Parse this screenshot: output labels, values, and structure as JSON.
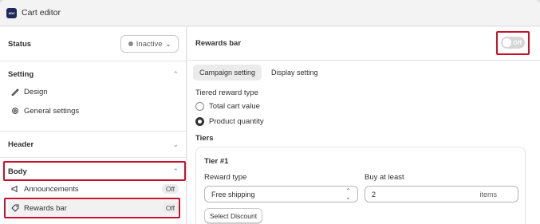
{
  "app": {
    "logo_text": "ADV",
    "title": "Cart editor"
  },
  "status": {
    "label": "Status",
    "value": "Inactive"
  },
  "setting": {
    "label": "Setting",
    "items": [
      {
        "label": "Design"
      },
      {
        "label": "General settings"
      }
    ]
  },
  "header_section": {
    "label": "Header"
  },
  "body_section": {
    "label": "Body",
    "items": [
      {
        "label": "Announcements",
        "badge": "Off"
      },
      {
        "label": "Rewards bar",
        "badge": "Off"
      }
    ]
  },
  "rewards": {
    "title": "Rewards bar",
    "toggle_label": "Off",
    "tabs": [
      {
        "label": "Campaign setting"
      },
      {
        "label": "Display setting"
      }
    ],
    "tier_type_label": "Tiered reward type",
    "options": [
      {
        "label": "Total cart value"
      },
      {
        "label": "Product quantity"
      }
    ],
    "selected_option": "Product quantity",
    "tiers_label": "Tiers",
    "tier": {
      "title": "Tier #1",
      "reward_type_label": "Reward type",
      "reward_type_value": "Free shipping",
      "buy_at_least_label": "Buy at least",
      "buy_at_least_value": "2",
      "buy_at_least_suffix": "items",
      "select_discount_label": "Select Discount"
    }
  },
  "colors": {
    "highlight": "#c8102e",
    "app_logo_bg": "#1f2a5c"
  }
}
